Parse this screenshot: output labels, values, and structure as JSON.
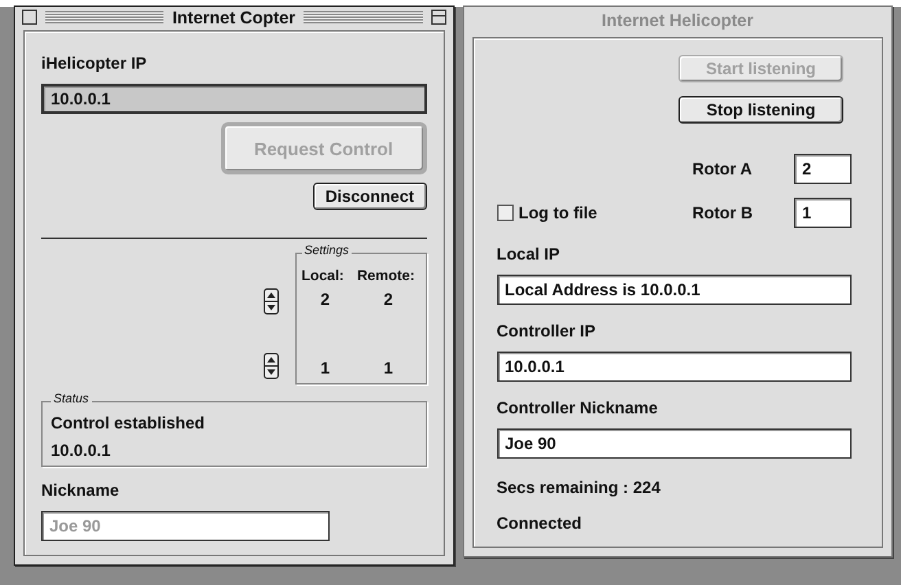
{
  "windows": [
    {
      "title": "Internet Copter",
      "active": true,
      "ip_label": "iHelicopter IP",
      "ip_field": {
        "value": "10.0.0.1"
      },
      "request_button": {
        "label": "Request Control",
        "disabled": true
      },
      "disconnect_button": {
        "label": "Disconnect",
        "disabled": false
      },
      "settings": {
        "title": "Settings",
        "columns": [
          "Local:",
          "Remote:"
        ],
        "rows": [
          {
            "local": "2",
            "remote": "2"
          },
          {
            "local": "1",
            "remote": "1"
          }
        ]
      },
      "status": {
        "title": "Status",
        "lines": [
          "Control established",
          "10.0.0.1"
        ]
      },
      "nickname_label": "Nickname",
      "nickname_field": {
        "placeholder": "Joe 90"
      }
    },
    {
      "title": "Internet Helicopter",
      "active": false,
      "start_button": {
        "label": "Start listening",
        "disabled": true
      },
      "stop_button": {
        "label": "Stop listening",
        "disabled": false
      },
      "rotors": [
        {
          "label": "Rotor A",
          "value": "2"
        },
        {
          "label": "Rotor B",
          "value": "1"
        }
      ],
      "log_checkbox": {
        "label": "Log to file",
        "checked": false
      },
      "fields": [
        {
          "label": "Local IP",
          "value": "Local Address is 10.0.0.1"
        },
        {
          "label": "Controller IP",
          "value": "10.0.0.1"
        },
        {
          "label": "Controller Nickname",
          "value": "Joe 90"
        }
      ],
      "secs_remaining": "Secs remaining : 224",
      "connection": "Connected"
    }
  ]
}
